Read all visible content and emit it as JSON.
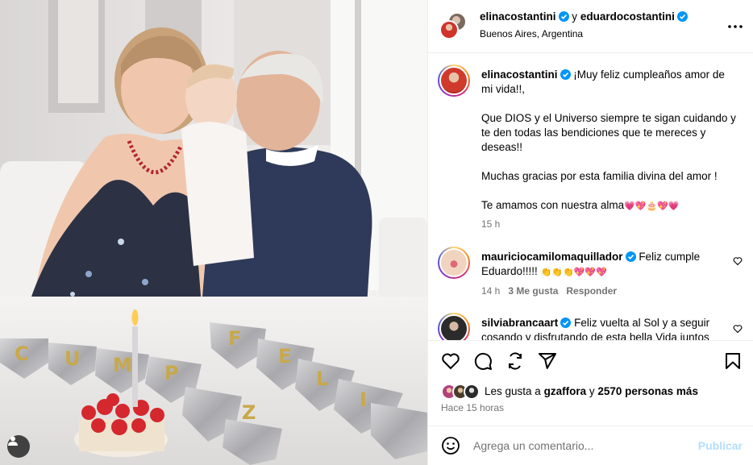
{
  "header": {
    "user1": "elinacostantini",
    "conjunction": "y",
    "user2": "eduardocostantini",
    "location": "Buenos Aires, Argentina"
  },
  "caption": {
    "username": "elinacostantini",
    "line1": "¡Muy feliz cumpleaños amor de mi vida!!,",
    "line2": "Que DIOS y el Universo siempre te sigan cuidando y te den todas las bendiciones que te mereces y deseas!!",
    "line3": "Muchas gracias por esta familia divina del amor !",
    "line4": "Te amamos con nuestra alma",
    "line4_emojis": [
      "💗",
      "💖",
      "🎂",
      "💖",
      "💗"
    ],
    "time": "15 h"
  },
  "comments": [
    {
      "username": "mauriciocamilomaquillador",
      "text": "Feliz cumple Eduardo!!!!!",
      "emojis": [
        "👏",
        "👏",
        "👏",
        "💖",
        "💖",
        "💖"
      ],
      "time": "14 h",
      "likes": "3 Me gusta",
      "reply": "Responder"
    },
    {
      "username": "silviabrancaart",
      "text": "Feliz vuelta al Sol y a seguir cosando y disfrutando de esta bella Vida juntos"
    }
  ],
  "likes": {
    "prefix": "Les gusta a",
    "user": "gzaffora",
    "joiner": "y",
    "count": "2570 personas más"
  },
  "posted_ago": "Hace 15 horas",
  "composer": {
    "placeholder": "Agrega un comentario...",
    "publish": "Publicar"
  },
  "photo": {
    "banner_letters_left": [
      "C",
      "U",
      "M",
      "P"
    ],
    "banner_letters_right": [
      "F",
      "E",
      "L",
      "I",
      "Z"
    ]
  },
  "colors": {
    "verified": "#0095f6",
    "publish_disabled": "#b2dffc",
    "muted_text": "#737373",
    "divider": "#efefef"
  },
  "icons": [
    "verified-badge",
    "more-icon",
    "heart-icon",
    "comment-icon",
    "share-icon",
    "send-icon",
    "save-icon",
    "emoji-icon",
    "user-tag-icon"
  ]
}
